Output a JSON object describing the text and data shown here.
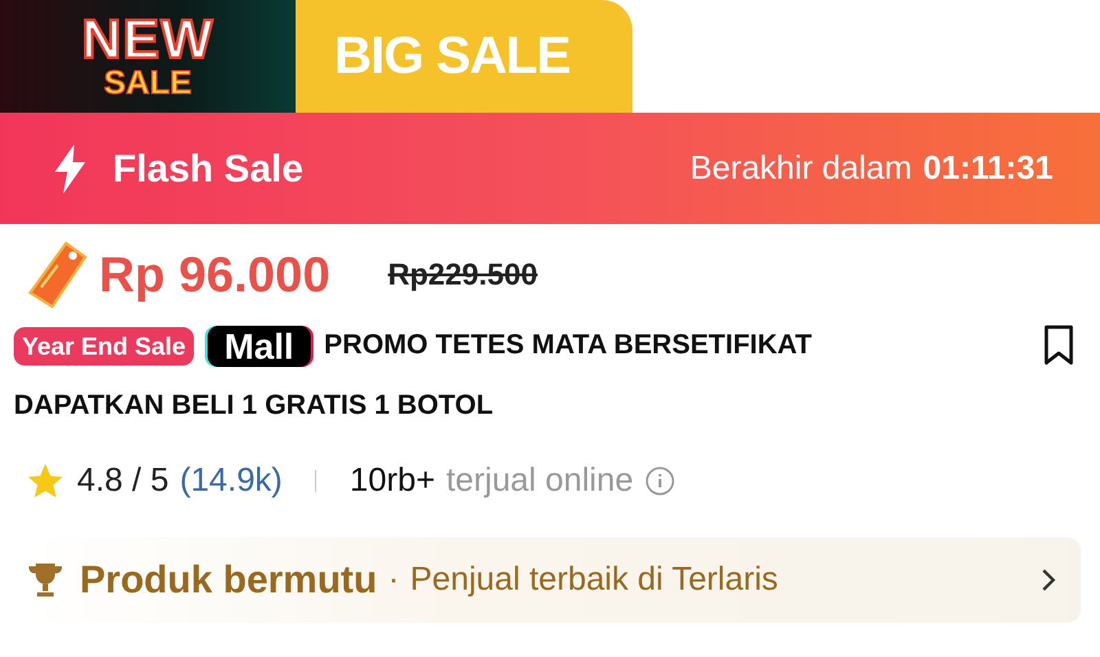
{
  "banner": {
    "badge_top": "NEW",
    "badge_bottom": "SALE",
    "headline": "BIG SALE"
  },
  "flash_sale": {
    "label": "Flash Sale",
    "ends_label": "Berakhir dalam",
    "countdown": "01:11:31"
  },
  "price": {
    "current": "Rp 96.000",
    "original": "Rp229.500"
  },
  "tags": [
    {
      "kind": "event",
      "text": "Year End Sale"
    },
    {
      "kind": "mall",
      "text": "Mall"
    }
  ],
  "title_lines": [
    "PROMO TETES MATA BERSETIFIKAT",
    "DAPATKAN BELI 1 GRATIS 1 BOTOL"
  ],
  "bookmarked": false,
  "rating": {
    "score": "4.8 / 5",
    "count": "(14.9k)",
    "sold": "10rb+",
    "sold_label": "terjual online"
  },
  "quality": {
    "title": "Produk bermutu",
    "separator": "·",
    "subtitle": "Penjual terbaik di Terlaris"
  }
}
